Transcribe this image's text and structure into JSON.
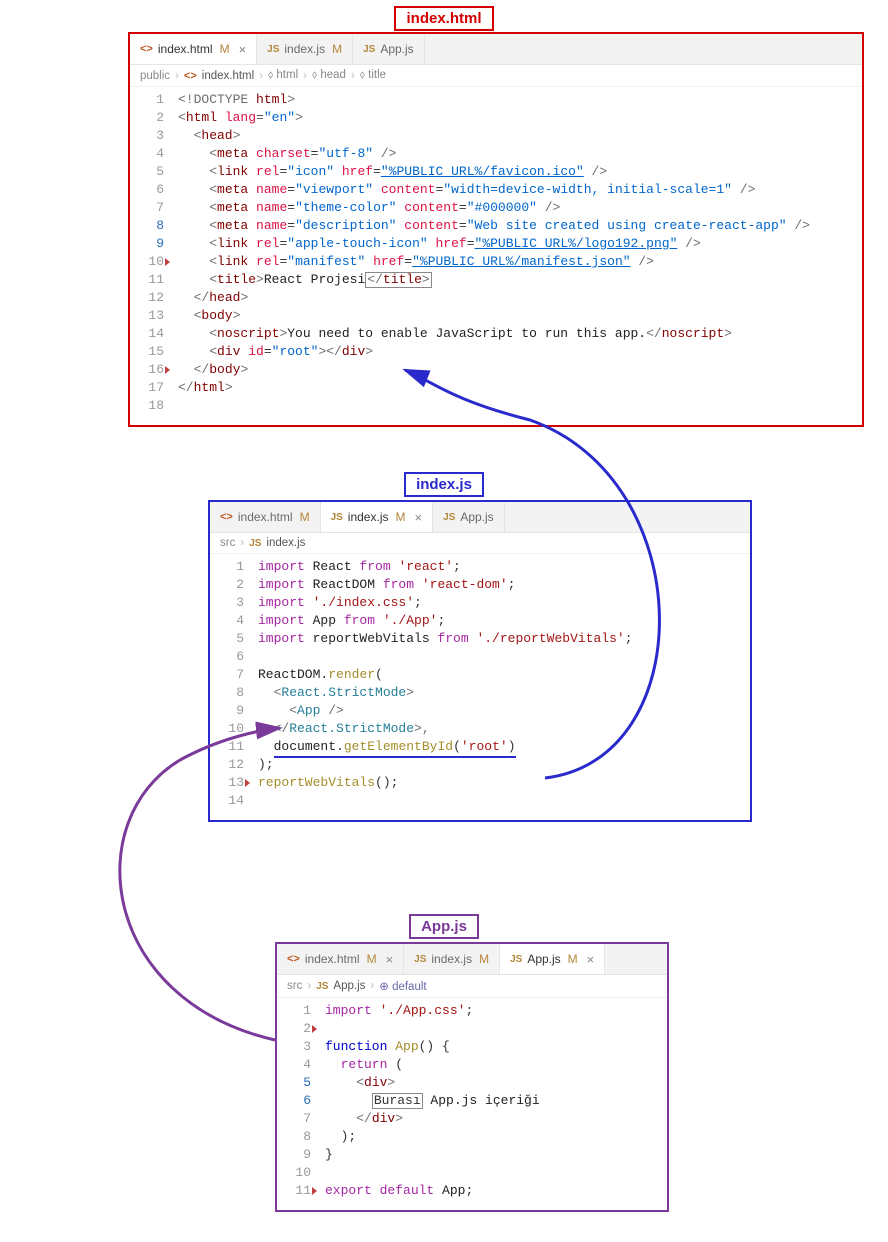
{
  "labels": {
    "indexHtml": "index.html",
    "indexJs": "index.js",
    "appJs": "App.js"
  },
  "panel1": {
    "tabs": [
      {
        "icon": "html",
        "name": "index.html",
        "mod": "M",
        "active": true,
        "close": true
      },
      {
        "icon": "js",
        "name": "index.js",
        "mod": "M",
        "active": false,
        "close": false
      },
      {
        "icon": "js",
        "name": "App.js",
        "mod": "",
        "active": false,
        "close": false
      }
    ],
    "breadcrumb": [
      "public",
      "index.html",
      "html",
      "head",
      "title"
    ],
    "crumbIcons": [
      "",
      "html",
      "cube",
      "cube",
      "cube"
    ],
    "lineNumbers": [
      1,
      2,
      3,
      4,
      5,
      6,
      7,
      8,
      9,
      10,
      11,
      12,
      13,
      14,
      15,
      16,
      17,
      18
    ],
    "hlLines": [
      8,
      9
    ],
    "redTri": [
      10,
      16
    ],
    "code": {
      "l1": {
        "a": "<!DOCTYPE ",
        "b": "html",
        "c": ">"
      },
      "l2": {
        "a": "<",
        "b": "html",
        "c": " lang",
        "d": "=",
        "e": "\"en\"",
        "f": ">"
      },
      "l3": {
        "a": "  <",
        "b": "head",
        "c": ">"
      },
      "l4": {
        "a": "    <",
        "b": "meta",
        "c": " charset",
        "d": "=",
        "e": "\"utf-8\"",
        "f": " />"
      },
      "l5": {
        "a": "    <",
        "b": "link",
        "c": " rel",
        "d": "=",
        "e": "\"icon\"",
        "f": " href",
        "g": "=",
        "h": "\"%PUBLIC_URL%/favicon.ico\"",
        "i": " />"
      },
      "l6": {
        "a": "    <",
        "b": "meta",
        "c": " name",
        "d": "=",
        "e": "\"viewport\"",
        "f": " content",
        "g": "=",
        "h": "\"width=device-width, initial-scale=1\"",
        "i": " />"
      },
      "l7": {
        "a": "    <",
        "b": "meta",
        "c": " name",
        "d": "=",
        "e": "\"theme-color\"",
        "f": " content",
        "g": "=",
        "h": "\"#000000\"",
        "i": " />"
      },
      "l8": {
        "a": "    <",
        "b": "meta",
        "c": " name",
        "d": "=",
        "e": "\"description\"",
        "f": " content",
        "g": "=",
        "h": "\"Web site created using create-react-app\"",
        "i": " />"
      },
      "l9": {
        "a": "    <",
        "b": "link",
        "c": " rel",
        "d": "=",
        "e": "\"apple-touch-icon\"",
        "f": " href",
        "g": "=",
        "h": "\"%PUBLIC_URL%/logo192.png\"",
        "i": " />"
      },
      "l10": {
        "a": "    <",
        "b": "link",
        "c": " rel",
        "d": "=",
        "e": "\"manifest\"",
        "f": " href",
        "g": "=",
        "h": "\"%PUBLIC_URL%/manifest.json\"",
        "i": " />"
      },
      "l11": {
        "a": "    <",
        "b": "title",
        "c": ">",
        "d": "React Projesi",
        "e": "<",
        "f": "/",
        "g": "title",
        "h": ">"
      },
      "l12": {
        "a": "  </",
        "b": "head",
        "c": ">"
      },
      "l13": {
        "a": "  <",
        "b": "body",
        "c": ">"
      },
      "l14": {
        "a": "    <",
        "b": "noscript",
        "c": ">",
        "d": "You need to enable JavaScript to run this app.",
        "e": "</",
        "f": "noscript",
        "g": ">"
      },
      "l15": {
        "a": "    <",
        "b": "div",
        "c": " id",
        "d": "=",
        "e": "\"root\"",
        "f": "></",
        "g": "div",
        "h": ">"
      },
      "l16": {
        "a": "  </",
        "b": "body",
        "c": ">"
      },
      "l17": {
        "a": "</",
        "b": "html",
        "c": ">"
      },
      "l18": {
        "a": ""
      }
    }
  },
  "panel2": {
    "tabs": [
      {
        "icon": "html",
        "name": "index.html",
        "mod": "M",
        "active": false,
        "close": false
      },
      {
        "icon": "js",
        "name": "index.js",
        "mod": "M",
        "active": true,
        "close": true
      },
      {
        "icon": "js",
        "name": "App.js",
        "mod": "",
        "active": false,
        "close": false
      }
    ],
    "breadcrumb": [
      "src",
      "index.js"
    ],
    "crumbIcons": [
      "",
      "js"
    ],
    "lineNumbers": [
      1,
      2,
      3,
      4,
      5,
      6,
      7,
      8,
      9,
      10,
      11,
      12,
      13,
      14
    ],
    "redTri": [
      13
    ],
    "code": {
      "l1": {
        "a": "import ",
        "b": "React",
        "c": " from ",
        "d": "'react'",
        "e": ";"
      },
      "l2": {
        "a": "import ",
        "b": "ReactDOM",
        "c": " from ",
        "d": "'react-dom'",
        "e": ";"
      },
      "l3": {
        "a": "import ",
        "b": "'./index.css'",
        "c": ";"
      },
      "l4": {
        "a": "import ",
        "b": "App",
        "c": " from ",
        "d": "'./App'",
        "e": ";"
      },
      "l5": {
        "a": "import ",
        "b": "reportWebVitals",
        "c": " from ",
        "d": "'./reportWebVitals'",
        "e": ";"
      },
      "l6": {
        "a": ""
      },
      "l7": {
        "a": "ReactDOM",
        "b": ".",
        "c": "render",
        "d": "("
      },
      "l8": {
        "a": "  <",
        "b": "React.StrictMode",
        "c": ">"
      },
      "l9": {
        "a": "    <",
        "b": "App",
        "c": " />"
      },
      "l10": {
        "a": "  </",
        "b": "React.StrictMode",
        "c": ">,"
      },
      "l11": {
        "a": "  ",
        "b": "document",
        "c": ".",
        "d": "getElementById",
        "e": "(",
        "f": "'root'",
        "g": ")"
      },
      "l12": {
        "a": ");"
      },
      "l13": {
        "a": "reportWebVitals",
        "b": "();"
      },
      "l14": {
        "a": ""
      }
    }
  },
  "panel3": {
    "tabs": [
      {
        "icon": "html",
        "name": "index.html",
        "mod": "M",
        "active": false,
        "close": true
      },
      {
        "icon": "js",
        "name": "index.js",
        "mod": "M",
        "active": false,
        "close": false
      },
      {
        "icon": "js",
        "name": "App.js",
        "mod": "M",
        "active": true,
        "close": true
      }
    ],
    "breadcrumb": [
      "src",
      "App.js",
      "default"
    ],
    "crumbIcons": [
      "",
      "js",
      "purple"
    ],
    "lineNumbers": [
      1,
      2,
      3,
      4,
      5,
      6,
      7,
      8,
      9,
      10,
      11
    ],
    "hlLines": [
      5,
      6
    ],
    "redTri": [
      2,
      11
    ],
    "code": {
      "l1": {
        "a": "import ",
        "b": "'./App.css'",
        "c": ";"
      },
      "l2": {
        "a": ""
      },
      "l3": {
        "a": "function ",
        "b": "App",
        "c": "() {"
      },
      "l4": {
        "a": "  return ",
        "b": "("
      },
      "l5": {
        "a": "    <",
        "b": "div",
        "c": ">"
      },
      "l6": {
        "a": "      ",
        "b": "Burası",
        "c": " App.js içeriği"
      },
      "l7": {
        "a": "    </",
        "b": "div",
        "c": ">"
      },
      "l8": {
        "a": "  );"
      },
      "l9": {
        "a": "}"
      },
      "l10": {
        "a": ""
      },
      "l11": {
        "a": "export ",
        "b": "default ",
        "c": "App",
        "d": ";"
      }
    }
  }
}
